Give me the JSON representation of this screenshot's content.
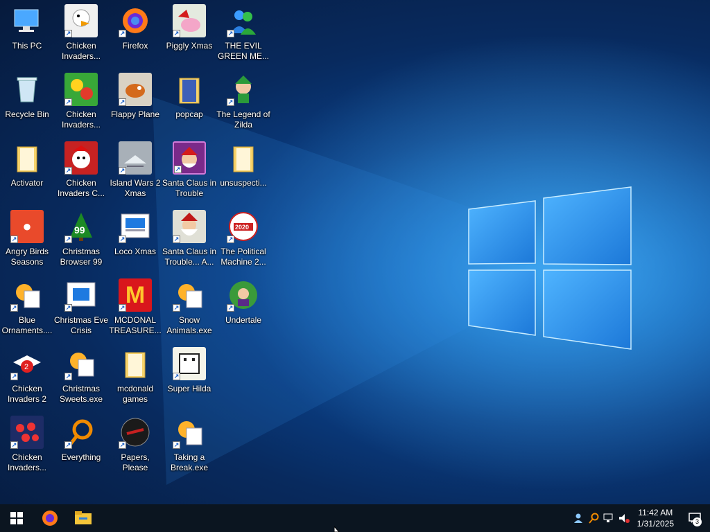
{
  "desktop": {
    "icons": [
      {
        "label": "This PC",
        "icon": "computer-icon",
        "shortcut": false
      },
      {
        "label": "Recycle Bin",
        "icon": "recycle-bin-icon",
        "shortcut": false
      },
      {
        "label": "Activator",
        "icon": "folder-icon",
        "shortcut": false
      },
      {
        "label": "Angry Birds Seasons",
        "icon": "angry-birds-icon",
        "shortcut": true
      },
      {
        "label": "Blue Ornaments....",
        "icon": "screensaver-icon",
        "shortcut": true
      },
      {
        "label": "Chicken Invaders 2",
        "icon": "chicken-invaders-icon",
        "shortcut": true
      },
      {
        "label": "Chicken Invaders...",
        "icon": "chicken-invaders-icon",
        "shortcut": true
      },
      {
        "label": "Chicken Invaders...",
        "icon": "chicken-invaders-icon",
        "shortcut": true
      },
      {
        "label": "Chicken Invaders...",
        "icon": "chicken-invaders-icon",
        "shortcut": true
      },
      {
        "label": "Chicken Invaders C...",
        "icon": "chicken-invaders-icon",
        "shortcut": true
      },
      {
        "label": "Christmas Browser 99",
        "icon": "christmas-tree-icon",
        "shortcut": true
      },
      {
        "label": "Christmas Eve Crisis",
        "icon": "window-app-icon",
        "shortcut": true
      },
      {
        "label": "Christmas Sweets.exe",
        "icon": "screensaver-icon",
        "shortcut": true
      },
      {
        "label": "Everything",
        "icon": "magnifier-icon",
        "shortcut": true
      },
      {
        "label": "Firefox",
        "icon": "firefox-icon",
        "shortcut": true
      },
      {
        "label": "Flappy Plane",
        "icon": "game-icon",
        "shortcut": true
      },
      {
        "label": "Island Wars 2 Xmas",
        "icon": "game-icon",
        "shortcut": true
      },
      {
        "label": "Loco Xmas",
        "icon": "window-app-icon",
        "shortcut": true
      },
      {
        "label": "MCDONAL TREASURE...",
        "icon": "mcdonalds-icon",
        "shortcut": true
      },
      {
        "label": "mcdonald games",
        "icon": "folder-icon",
        "shortcut": false
      },
      {
        "label": "Papers, Please",
        "icon": "papers-please-icon",
        "shortcut": true
      },
      {
        "label": "Piggly Xmas",
        "icon": "game-icon",
        "shortcut": true
      },
      {
        "label": "popcap",
        "icon": "folder-icon",
        "shortcut": false
      },
      {
        "label": "Santa Claus in Trouble",
        "icon": "santa-icon",
        "shortcut": true
      },
      {
        "label": "Santa Claus in Trouble... A...",
        "icon": "santa-icon",
        "shortcut": true
      },
      {
        "label": "Snow Animals.exe",
        "icon": "screensaver-icon",
        "shortcut": true
      },
      {
        "label": "Super Hilda",
        "icon": "game-icon",
        "shortcut": true
      },
      {
        "label": "Taking a Break.exe",
        "icon": "screensaver-icon",
        "shortcut": true
      },
      {
        "label": "THE EVIL GREEN ME...",
        "icon": "messenger-icon",
        "shortcut": true
      },
      {
        "label": "The Legend of Zilda",
        "icon": "game-icon",
        "shortcut": true
      },
      {
        "label": "unsuspecti...",
        "icon": "folder-icon",
        "shortcut": false
      },
      {
        "label": "The Political Machine 2...",
        "icon": "political-machine-icon",
        "shortcut": true
      },
      {
        "label": "Undertale",
        "icon": "undertale-icon",
        "shortcut": true
      }
    ]
  },
  "taskbar": {
    "start_icon": "windows-logo-icon",
    "pinned": [
      {
        "name": "firefox-taskbar-icon"
      },
      {
        "name": "file-explorer-icon"
      }
    ],
    "clock": {
      "time": "11:42 AM",
      "date": "1/31/2025"
    },
    "notification_count": "3"
  },
  "colors": {
    "taskbar": "#0b1520",
    "desktop_accent": "#1a7fe0"
  }
}
